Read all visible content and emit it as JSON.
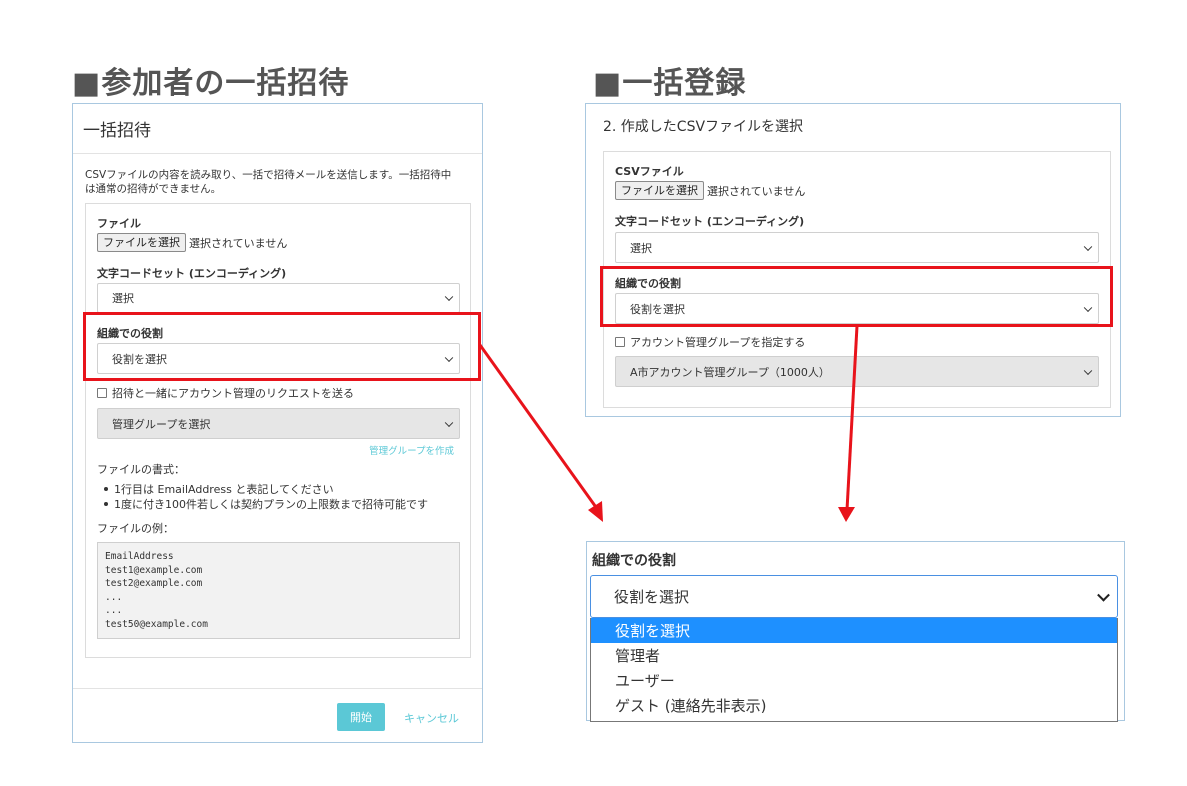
{
  "left": {
    "section_title": "■参加者の一括招待",
    "panel_title": "一括招待",
    "description_line1": "CSVファイルの内容を読み取り、一括で招待メールを送信します。一括招待中",
    "description_line2": "は通常の招待ができません。",
    "file_label": "ファイル",
    "file_button": "ファイルを選択",
    "file_status": "選択されていません",
    "encoding_label": "文字コードセット (エンコーディング)",
    "encoding_value": "選択",
    "role_label": "組織での役割",
    "role_value": "役割を選択",
    "checkbox_label": "招待と一緒にアカウント管理のリクエストを送る",
    "group_value": "管理グループを選択",
    "group_link": "管理グループを作成",
    "format_label": "ファイルの書式：",
    "format_items": [
      "1行目は EmailAddress と表記してください",
      "1度に付き100件若しくは契約プランの上限数まで招待可能です"
    ],
    "example_label": "ファイルの例：",
    "example_lines": [
      "EmailAddress",
      "test1@example.com",
      "test2@example.com",
      "...",
      "...",
      "test50@example.com"
    ],
    "start_button": "開始",
    "cancel_button": "キャンセル"
  },
  "right": {
    "section_title": "■一括登録",
    "panel_title": "2. 作成したCSVファイルを選択",
    "csv_label": "CSVファイル",
    "file_button": "ファイルを選択",
    "file_status": "選択されていません",
    "encoding_label": "文字コードセット (エンコーディング)",
    "encoding_value": "選択",
    "role_label": "組織での役割",
    "role_value": "役割を選択",
    "checkbox_label": "アカウント管理グループを指定する",
    "group_value": "A市アカウント管理グループ（1000人）"
  },
  "zoom": {
    "role_label": "組織での役割",
    "select_value": "役割を選択",
    "options": [
      "役割を選択",
      "管理者",
      "ユーザー",
      "ゲスト (連絡先非表示)"
    ],
    "highlighted_index": 0
  },
  "colors": {
    "highlight_red": "#e8131b",
    "accent_teal": "#5bc8d6",
    "option_highlight": "#1e90ff",
    "panel_border": "#a9c8e0"
  }
}
